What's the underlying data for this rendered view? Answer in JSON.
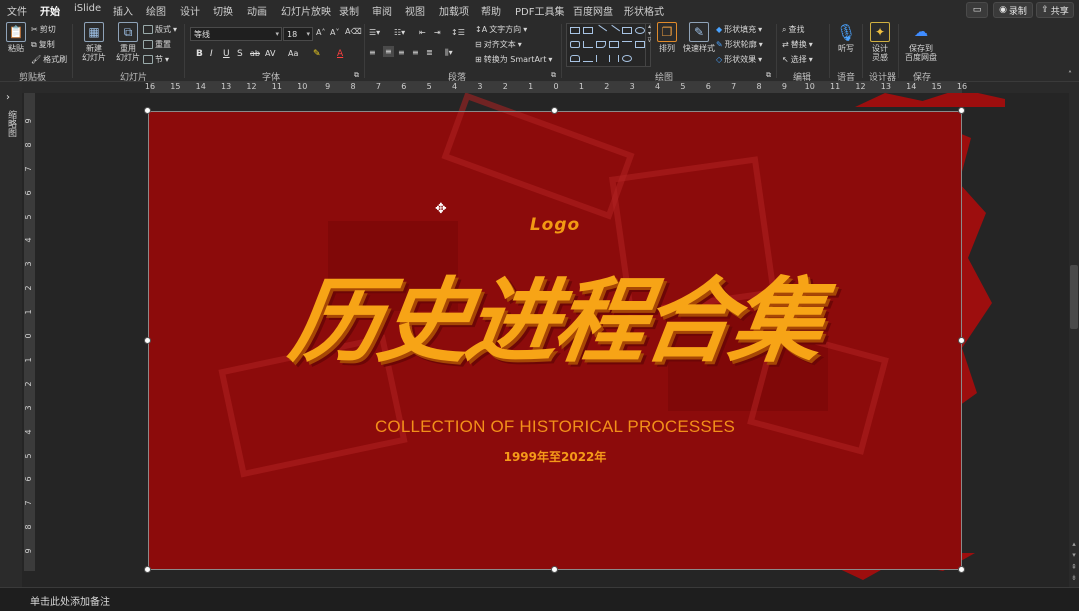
{
  "menu": {
    "tabs": [
      "文件",
      "开始",
      "iSlide",
      "插入",
      "绘图",
      "设计",
      "切换",
      "动画",
      "幻灯片放映",
      "录制",
      "审阅",
      "视图",
      "加载项",
      "帮助",
      "PDF工具集",
      "百度网盘",
      "形状格式"
    ],
    "active_tab": "开始",
    "comment_icon": "comment-icon",
    "record_label": "录制",
    "share_label": "共享"
  },
  "ribbon": {
    "clipboard": {
      "paste": "粘贴",
      "cut": "剪切",
      "copy": "复制",
      "format_painter": "格式刷",
      "group": "剪贴板"
    },
    "slides": {
      "new_slide": "新建\n幻灯片",
      "reuse": "重用\n幻灯片",
      "layout": "版式",
      "reset": "重置",
      "section": "节",
      "group": "幻灯片"
    },
    "font": {
      "font_name": "等线",
      "font_size": "18",
      "group": "字体",
      "bold": "B",
      "italic": "I",
      "underline": "U",
      "shadow": "S",
      "strike": "ab",
      "spacing": "AV",
      "case": "Aa"
    },
    "paragraph": {
      "text_direction": "文字方向",
      "align_text": "对齐文本",
      "smartart": "转换为 SmartArt",
      "group": "段落"
    },
    "drawing": {
      "arrange": "排列",
      "quick_styles": "快速样式",
      "shape_fill": "形状填充",
      "shape_outline": "形状轮廓",
      "shape_effects": "形状效果",
      "group": "绘图"
    },
    "editing": {
      "find": "查找",
      "replace": "替换",
      "select": "选择",
      "group": "编辑"
    },
    "voice": {
      "dictate": "听写",
      "group": "语音"
    },
    "designer": {
      "design_ideas": "设计\n灵感",
      "group": "设计器"
    },
    "save": {
      "save_baidu": "保存到\n百度网盘",
      "group": "保存"
    }
  },
  "ruler": {
    "h_labels": [
      "16",
      "15",
      "14",
      "13",
      "12",
      "11",
      "10",
      "9",
      "8",
      "7",
      "6",
      "5",
      "4",
      "3",
      "2",
      "1",
      "0",
      "1",
      "2",
      "3",
      "4",
      "5",
      "6",
      "7",
      "8",
      "9",
      "10",
      "11",
      "12",
      "13",
      "14",
      "15",
      "16"
    ],
    "v_labels": [
      "9",
      "8",
      "7",
      "6",
      "5",
      "4",
      "3",
      "2",
      "1",
      "0",
      "1",
      "2",
      "3",
      "4",
      "5",
      "6",
      "7",
      "8",
      "9"
    ]
  },
  "rail": {
    "label": "缩略图"
  },
  "slide": {
    "logo": "Logo",
    "title": "历史进程合集",
    "subtitle": "COLLECTION OF HISTORICAL PROCESSES",
    "date": "1999年至2022年",
    "colors": {
      "background": "#8c0b0b",
      "accent": "#f7a416"
    }
  },
  "notes": {
    "placeholder": "单击此处添加备注"
  }
}
